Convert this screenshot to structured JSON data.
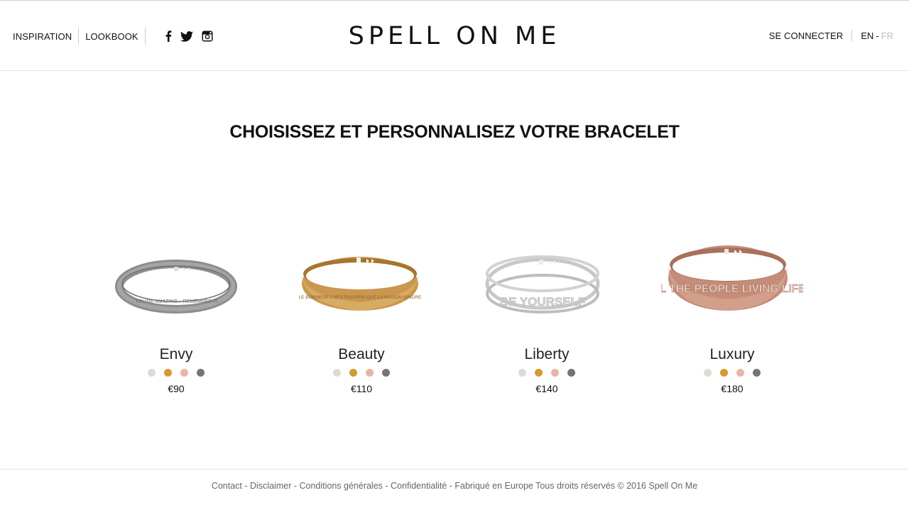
{
  "header": {
    "nav_left": [
      "INSPIRATION",
      "LOOKBOOK"
    ],
    "social_icons": [
      "facebook-icon",
      "twitter-icon",
      "instagram-icon"
    ],
    "logo": "SPELL ON ME",
    "login": "SE CONNECTER",
    "lang_active": "EN",
    "lang_dash": "-",
    "lang_inactive": "FR"
  },
  "main": {
    "title": "CHOISISSEZ ET PERSONNALISEZ VOTRE BRACELET"
  },
  "colors": {
    "silver": "#dcdcd4",
    "gold": "#d49a2e",
    "rose": "#e8b5a5",
    "grey": "#7a7373"
  },
  "products": [
    {
      "name": "Envy",
      "price": "€90",
      "engraving": "...YOU'RE AMAZING... REMEMBER IT...",
      "metal": "grey"
    },
    {
      "name": "Beauty",
      "price": "€110",
      "engraving": "LE BONHEUR A SES RAISONS QUE LA RAISON IGNORE",
      "metal": "gold"
    },
    {
      "name": "Liberty",
      "price": "€140",
      "engraving": "BE YOURSELF",
      "metal": "silver"
    },
    {
      "name": "Luxury",
      "price": "€180",
      "engraving": "IMAGINE ALL THE PEOPLE LIVING LIFE IN PEACE",
      "metal": "rose"
    }
  ],
  "footer": {
    "links": [
      "Contact",
      "Disclaimer",
      "Conditions générales",
      "Confidentialité"
    ],
    "sep": " - ",
    "text": "Fabriqué en Europe Tous droits réservés © 2016 Spell On Me"
  }
}
